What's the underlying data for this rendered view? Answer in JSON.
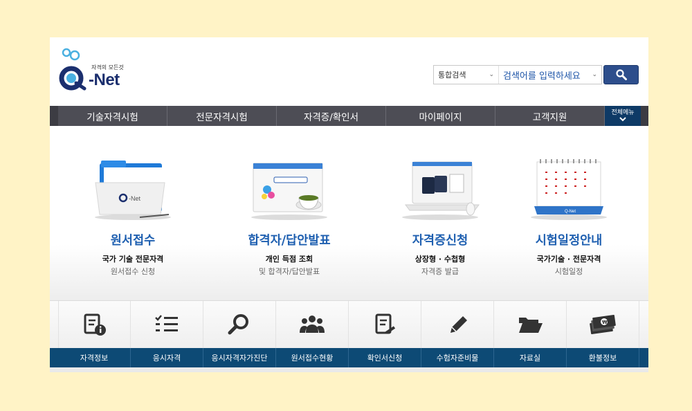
{
  "header": {
    "logo_tagline": "자격의 모든것",
    "logo_text": "-Net",
    "search": {
      "scope_label": "통합검색",
      "placeholder": "검색어를 입력하세요"
    }
  },
  "nav": {
    "items": [
      "기술자격시험",
      "전문자격시험",
      "자격증/확인서",
      "마이페이지",
      "고객지원"
    ],
    "all_menu_label": "전체메뉴"
  },
  "features": [
    {
      "title": "원서접수",
      "sub1": "국가 기술 전문자격",
      "sub2": "원서접수 신청",
      "icon": "folder-icon"
    },
    {
      "title": "합격자/답안발표",
      "sub1": "개인 득점 조회",
      "sub2": "및 합격자/답안발표",
      "icon": "browser-window-icon"
    },
    {
      "title": "자격증신청",
      "sub1": "상장형 · 수첩형",
      "sub2": "자격증 발급",
      "icon": "laptop-certificate-icon"
    },
    {
      "title": "시험일정안내",
      "sub1": "국가기술 · 전문자격",
      "sub2": "시험일정",
      "icon": "calendar-icon"
    }
  ],
  "quick_links": [
    {
      "label": "자격정보",
      "icon": "document-info-icon"
    },
    {
      "label": "응시자격",
      "icon": "checklist-icon"
    },
    {
      "label": "응시자격자가진단",
      "icon": "magnifier-icon"
    },
    {
      "label": "원서접수현황",
      "icon": "people-icon"
    },
    {
      "label": "확인서신청",
      "icon": "document-edit-icon"
    },
    {
      "label": "수험자준비물",
      "icon": "pencil-icon"
    },
    {
      "label": "자료실",
      "icon": "folder-open-icon"
    },
    {
      "label": "환불정보",
      "icon": "money-icon"
    }
  ],
  "colors": {
    "brand_blue": "#1e5fb0",
    "nav_bg": "#4d4d55",
    "nav_accent": "#0e3a66",
    "quick_bar": "#0d4a75",
    "outer_bg": "#fff3c6"
  }
}
